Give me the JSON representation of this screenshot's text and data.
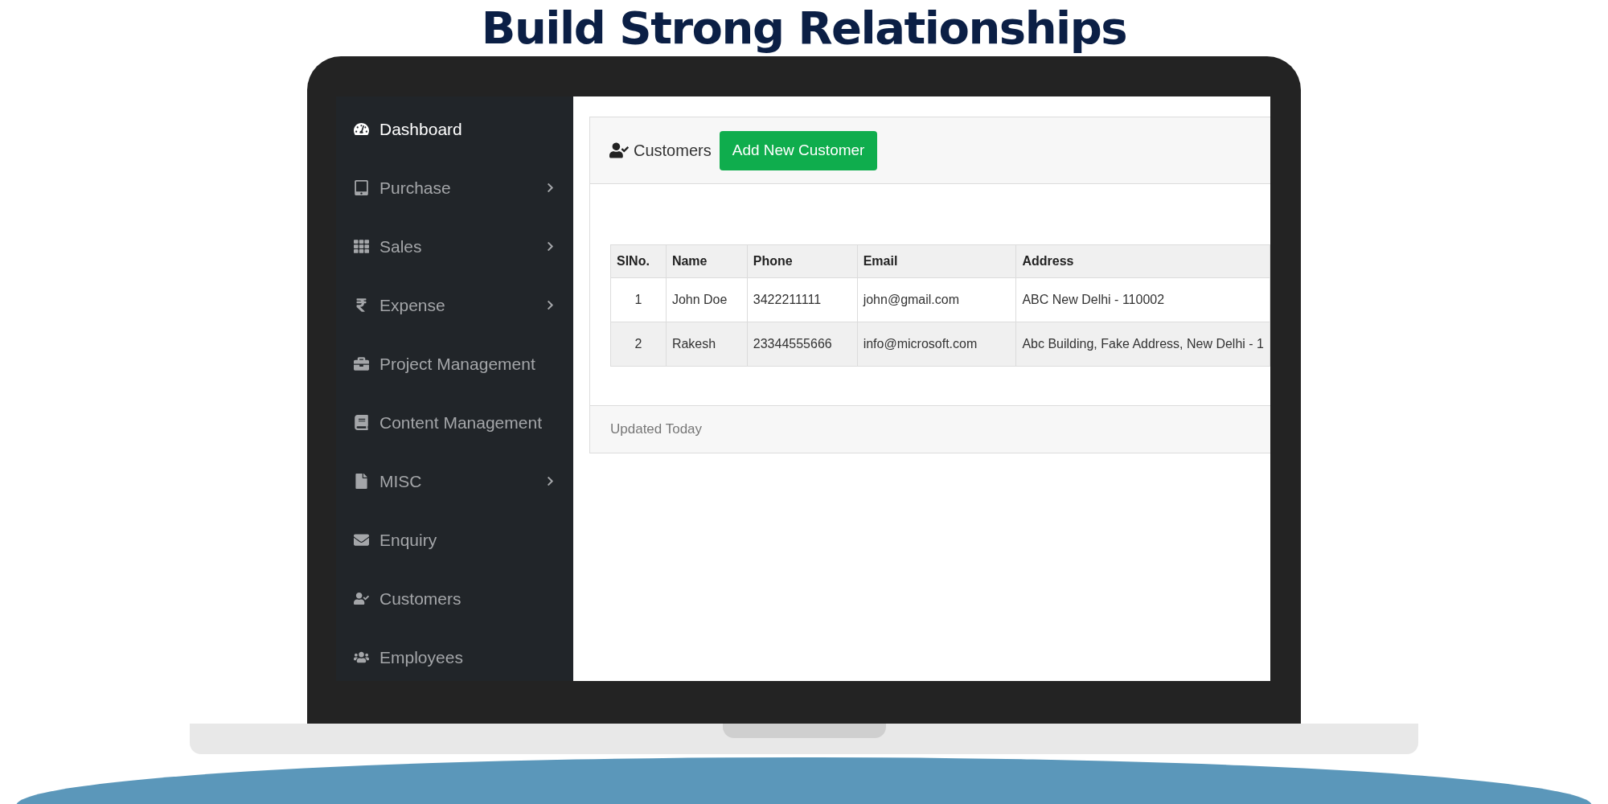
{
  "heading": "Build Strong Relationships",
  "sidebar": {
    "items": [
      {
        "label": "Dashboard",
        "selected": true,
        "has_submenu": false
      },
      {
        "label": "Purchase",
        "selected": false,
        "has_submenu": true
      },
      {
        "label": "Sales",
        "selected": false,
        "has_submenu": true
      },
      {
        "label": "Expense",
        "selected": false,
        "has_submenu": true
      },
      {
        "label": "Project Management",
        "selected": false,
        "has_submenu": false
      },
      {
        "label": "Content Management",
        "selected": false,
        "has_submenu": false
      },
      {
        "label": "MISC",
        "selected": false,
        "has_submenu": true
      },
      {
        "label": "Enquiry",
        "selected": false,
        "has_submenu": false
      },
      {
        "label": "Customers",
        "selected": false,
        "has_submenu": false
      },
      {
        "label": "Employees",
        "selected": false,
        "has_submenu": false
      }
    ]
  },
  "panel": {
    "title": "Customers",
    "add_button": "Add New Customer",
    "table": {
      "columns": [
        "SlNo.",
        "Name",
        "Phone",
        "Email",
        "Address"
      ],
      "rows": [
        [
          "1",
          "John Doe",
          "3422211111",
          "john@gmail.com",
          "ABC New Delhi - 110002"
        ],
        [
          "2",
          "Rakesh",
          "23344555666",
          "info@microsoft.com",
          "Abc Building, Fake Address, New Delhi - 1"
        ]
      ]
    },
    "footer": "Updated Today"
  }
}
